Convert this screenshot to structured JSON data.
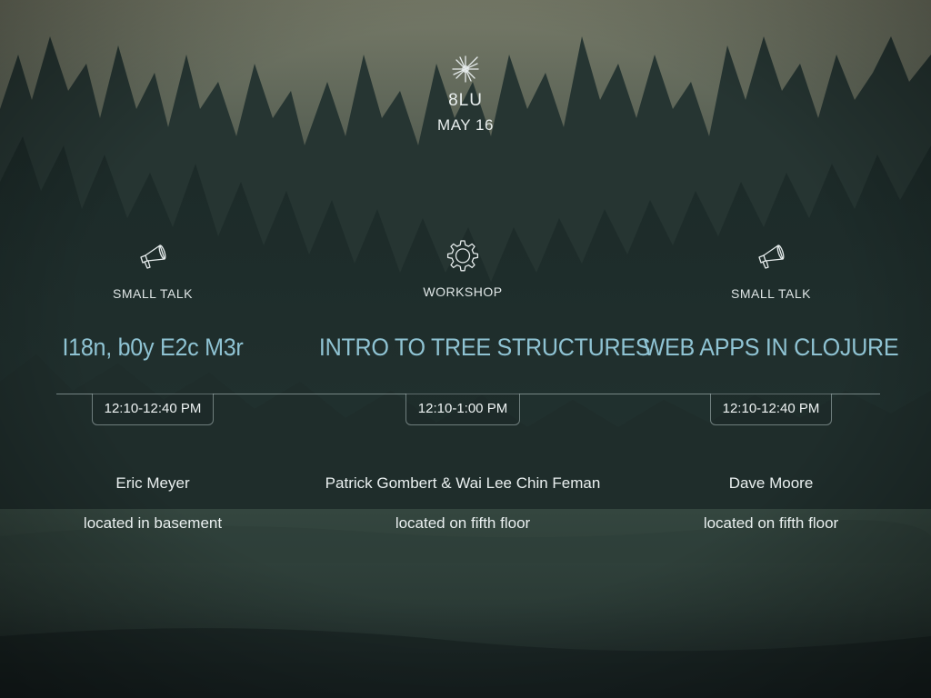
{
  "header": {
    "logo_icon": "starburst-icon",
    "brand": "8LU",
    "date": "MAY 16"
  },
  "sessions": [
    {
      "type_icon": "megaphone-icon",
      "type": "SMALL TALK",
      "title": "I18n, b0y E2c M3r",
      "time": "12:10-12:40 PM",
      "speaker": "Eric Meyer",
      "location": "located in basement"
    },
    {
      "type_icon": "gear-icon",
      "type": "WORKSHOP",
      "title": "INTRO TO TREE STRUCTURES",
      "time": "12:10-1:00 PM",
      "speaker": "Patrick Gombert  & Wai Lee Chin Feman",
      "location": "located on fifth floor"
    },
    {
      "type_icon": "megaphone-icon",
      "type": "SMALL TALK",
      "title": "WEB APPS IN CLOJURE",
      "time": "12:10-12:40 PM",
      "speaker": "Dave Moore",
      "location": "located on fifth floor"
    }
  ],
  "colors": {
    "title_accent": "#8fc3d3",
    "text": "#e8eeee",
    "sky_top": "#6f7464",
    "forest_dark": "#1b2726"
  }
}
